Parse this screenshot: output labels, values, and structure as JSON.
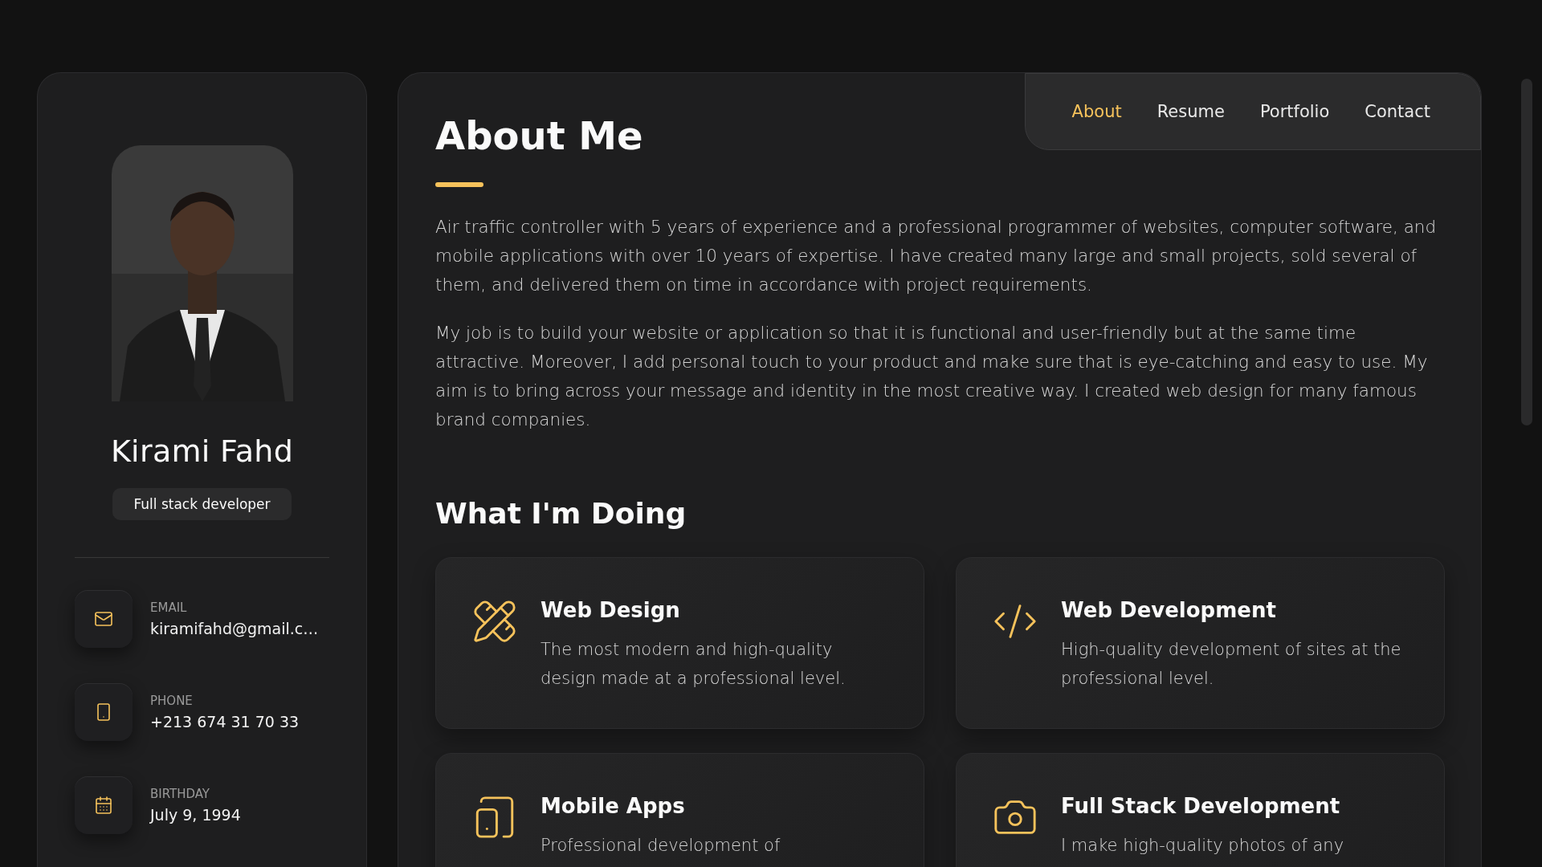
{
  "profile": {
    "name": "Kirami Fahd",
    "role": "Full stack developer"
  },
  "contacts": [
    {
      "label": "EMAIL",
      "value": "kiramifahd@gmail.c…"
    },
    {
      "label": "PHONE",
      "value": "+213 674 31 70 33"
    },
    {
      "label": "BIRTHDAY",
      "value": "July 9, 1994"
    }
  ],
  "nav": [
    {
      "label": "About",
      "selected": true
    },
    {
      "label": "Resume",
      "selected": false
    },
    {
      "label": "Portfolio",
      "selected": false
    },
    {
      "label": "Contact",
      "selected": false
    }
  ],
  "about": {
    "title": "About Me",
    "paragraphs": [
      "Air traffic controller with 5 years of experience and a professional programmer of websites, computer software, and mobile applications with over 10 years of expertise. I have created many large and small projects, sold several of them, and delivered them on time in accordance with project requirements.",
      "My job is to build your website or application so that it is functional and user-friendly but at the same time attractive. Moreover, I add personal touch to your product and make sure that is eye-catching and easy to use. My aim is to bring across your message and identity in the most creative way. I created web design for many famous brand companies."
    ]
  },
  "services": {
    "title": "What I'm Doing",
    "items": [
      {
        "title": "Web Design",
        "text": "The most modern and high-quality design made at a professional level."
      },
      {
        "title": "Web Development",
        "text": "High-quality development of sites at the professional level."
      },
      {
        "title": "Mobile Apps",
        "text": "Professional development of"
      },
      {
        "title": "Full Stack Development",
        "text": "I make high-quality photos of any"
      }
    ]
  }
}
